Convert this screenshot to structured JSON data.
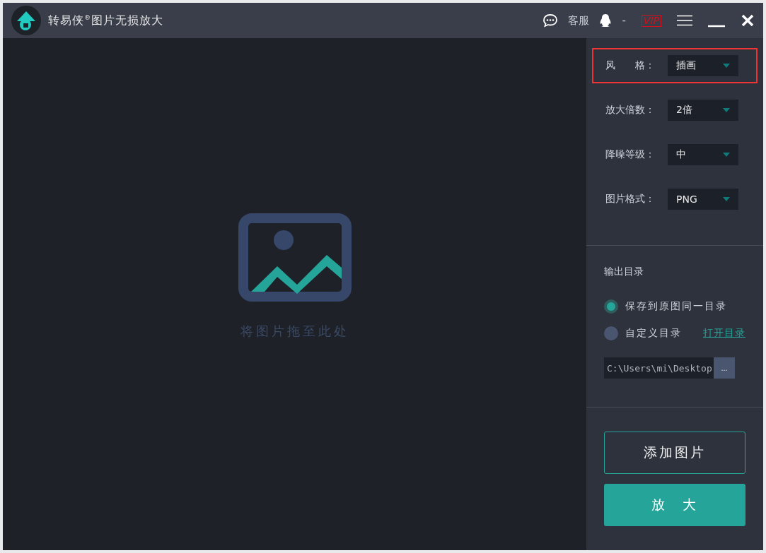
{
  "window": {
    "title": "转易侠$^{®}$图片无损放大",
    "service_label": "客服",
    "qq_label": "-",
    "vip_label": "VIP"
  },
  "drop_area": {
    "hint": "将图片拖至此处"
  },
  "settings": [
    {
      "label": "风　　格：",
      "value": "插画",
      "highlighted": true
    },
    {
      "label": "放大倍数：",
      "value": "2倍",
      "highlighted": false
    },
    {
      "label": "降噪等级：",
      "value": "中",
      "highlighted": false
    },
    {
      "label": "图片格式：",
      "value": "PNG",
      "highlighted": false
    }
  ],
  "output": {
    "heading": "输出目录",
    "options": [
      {
        "label": "保存到原图同一目录",
        "selected": true
      },
      {
        "label": "自定义目录",
        "selected": false
      }
    ],
    "open_link": "打开目录",
    "path": "C:\\Users\\mi\\Desktop",
    "browse": "..."
  },
  "buttons": [
    {
      "label": "添加图片",
      "kind": "outline"
    },
    {
      "label": "放　大",
      "kind": "primary"
    }
  ]
}
